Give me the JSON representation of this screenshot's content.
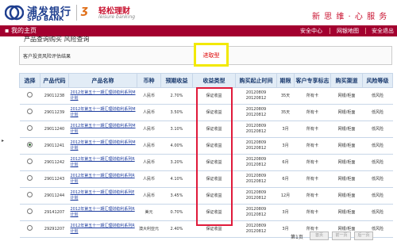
{
  "header": {
    "bank_cn": "浦发银行",
    "bank_en": "SPD BANK",
    "service_cn": "轻松理财",
    "service_en": "leisure banking",
    "slogan": "新 思 维 · 心 服 务",
    "brand_color": "#1f3f8f",
    "accent_color": "#c8102e"
  },
  "navbar": {
    "home": "我的主页",
    "links": [
      "安全中心",
      "网银地图",
      "安全退出"
    ],
    "color": "#a3002f"
  },
  "breadcrumb": "产品查询购买    风险查询",
  "risk_result": {
    "label": "客户投资风险评估结果",
    "value": "进取型"
  },
  "table": {
    "headers": [
      "选择",
      "产品代码",
      "产品名称",
      "币种",
      "预期收益",
      "收益类型",
      "购买起止时间",
      "期限",
      "客户专享标志",
      "购买渠道",
      "风险等级"
    ],
    "rows": [
      {
        "selected": false,
        "code": "29011238",
        "name": "2012年第五十一期汇理财稳利系列M计划",
        "currency": "人民币",
        "yield": "2.70%",
        "type": "保证收益",
        "period": "20120809\n20120812",
        "term": "35天",
        "exclusive": "所有卡",
        "channel": "网银/柜面",
        "risk": "低风险"
      },
      {
        "selected": false,
        "code": "29011239",
        "name": "2012年第五十一期汇理财稳利系列M计划",
        "currency": "人民币",
        "yield": "3.50%",
        "type": "保证收益",
        "period": "20120809\n20120812",
        "term": "35天",
        "exclusive": "所有卡",
        "channel": "网银/柜面",
        "risk": "低风险"
      },
      {
        "selected": false,
        "code": "29011240",
        "name": "2012年第五十一期汇理财稳利系列M计划",
        "currency": "人民币",
        "yield": "3.10%",
        "type": "保证收益",
        "period": "20120809\n20120812",
        "term": "3月",
        "exclusive": "所有卡",
        "channel": "网银/柜面",
        "risk": "低风险"
      },
      {
        "selected": true,
        "code": "29011241",
        "name": "2012年第五十一期汇理财稳利系列M计划",
        "currency": "人民币",
        "yield": "4.00%",
        "type": "保证收益",
        "period": "20120809\n20120812",
        "term": "3月",
        "exclusive": "所有卡",
        "channel": "网银/柜面",
        "risk": "低风险"
      },
      {
        "selected": false,
        "code": "29011242",
        "name": "2012年第五十一期汇理财稳利系列R计划",
        "currency": "人民币",
        "yield": "3.20%",
        "type": "保证收益",
        "period": "20120809\n20120812",
        "term": "6月",
        "exclusive": "所有卡",
        "channel": "网银/柜面",
        "risk": "低风险"
      },
      {
        "selected": false,
        "code": "29011243",
        "name": "2012年第五十一期汇理财稳利系列R计划",
        "currency": "人民币",
        "yield": "4.10%",
        "type": "保证收益",
        "period": "20120809\n20120812",
        "term": "6月",
        "exclusive": "所有卡",
        "channel": "网银/柜面",
        "risk": "低风险"
      },
      {
        "selected": false,
        "code": "29011244",
        "name": "2012年第五十一期汇理财稳利系列E计划",
        "currency": "人民币",
        "yield": "3.45%",
        "type": "保证收益",
        "period": "20120809\n20120812",
        "term": "12月",
        "exclusive": "所有卡",
        "channel": "网银/柜面",
        "risk": "低风险"
      },
      {
        "selected": false,
        "code": "29141207",
        "name": "2012年第五十一期汇理财稳利系列R计划",
        "currency": "美元",
        "yield": "0.70%",
        "type": "保证收益",
        "period": "20120809\n20120812",
        "term": "3月",
        "exclusive": "所有卡",
        "channel": "网银/柜面",
        "risk": "低风险"
      },
      {
        "selected": false,
        "code": "29291207",
        "name": "2012年第五十一期汇理财稳利系列R计划",
        "currency": "澳大利亚元",
        "yield": "2.40%",
        "type": "保证收益",
        "period": "20120809\n20120812",
        "term": "3月",
        "exclusive": "所有卡",
        "channel": "网银/柜面",
        "risk": "低风险"
      }
    ]
  },
  "pager": {
    "info": "第1页",
    "buttons": [
      "首页",
      "前一页",
      "后一页"
    ]
  },
  "left_marker": "▸"
}
